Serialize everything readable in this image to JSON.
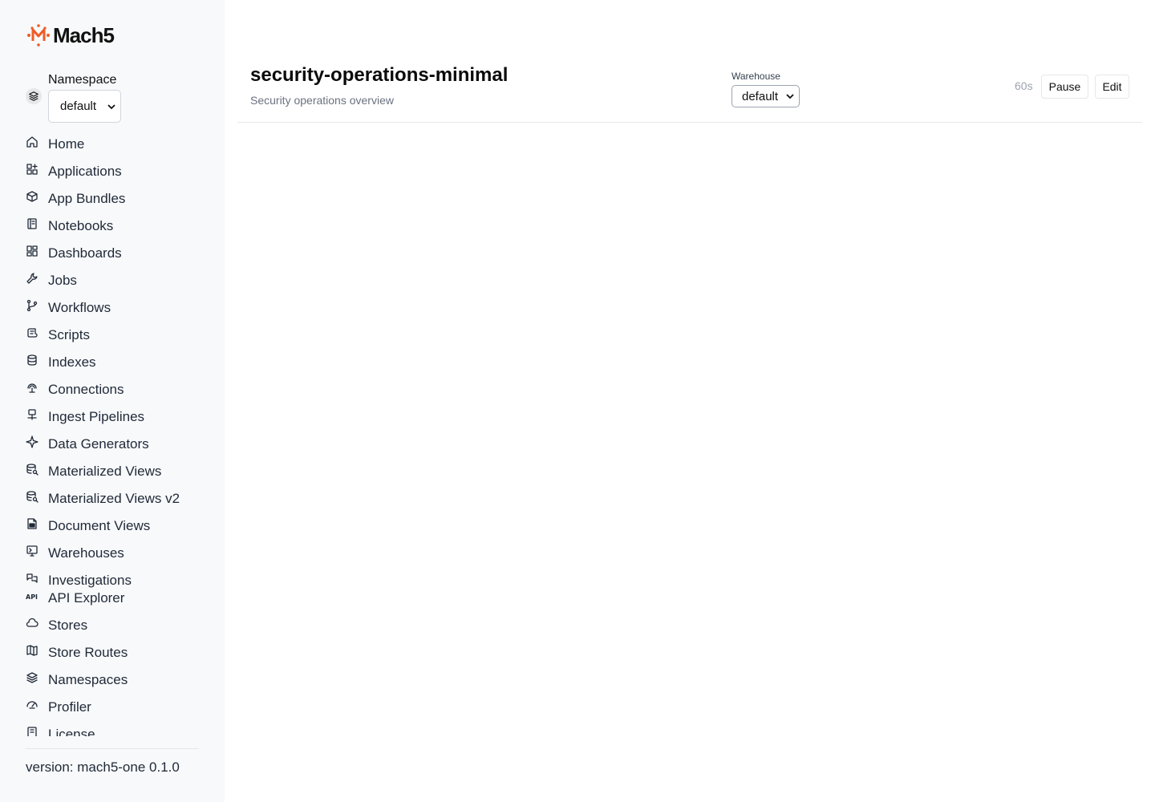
{
  "brand": {
    "name": "Mach5",
    "accent": "#ef5b25"
  },
  "namespace": {
    "label": "Namespace",
    "selected": "default"
  },
  "nav": {
    "items": [
      {
        "label": "Home",
        "icon": "home-icon"
      },
      {
        "label": "Applications",
        "icon": "applications-icon"
      },
      {
        "label": "App Bundles",
        "icon": "package-icon"
      },
      {
        "label": "Notebooks",
        "icon": "notebook-icon"
      },
      {
        "label": "Dashboards",
        "icon": "dashboard-icon"
      },
      {
        "label": "Jobs",
        "icon": "wrench-icon"
      },
      {
        "label": "Workflows",
        "icon": "git-branch-icon"
      },
      {
        "label": "Scripts",
        "icon": "script-icon"
      },
      {
        "label": "Indexes",
        "icon": "database-icon"
      },
      {
        "label": "Connections",
        "icon": "cable-icon"
      },
      {
        "label": "Ingest Pipelines",
        "icon": "network-icon"
      },
      {
        "label": "Data Generators",
        "icon": "sparkle-icon"
      },
      {
        "label": "Materialized Views",
        "icon": "database-search-icon"
      },
      {
        "label": "Materialized Views v2",
        "icon": "database-search-icon"
      },
      {
        "label": "Document Views",
        "icon": "file-icon"
      },
      {
        "label": "Warehouses",
        "icon": "monitor-icon"
      },
      {
        "label": "Investigations",
        "icon": "chat-icon"
      },
      {
        "label": "API Explorer",
        "icon": "api-icon"
      },
      {
        "label": "Stores",
        "icon": "cloud-icon"
      },
      {
        "label": "Store Routes",
        "icon": "map-icon"
      },
      {
        "label": "Namespaces",
        "icon": "layers-icon"
      },
      {
        "label": "Profiler",
        "icon": "gauge-icon"
      },
      {
        "label": "License",
        "icon": "license-icon"
      }
    ]
  },
  "footer": {
    "version": "version: mach5-one 0.1.0"
  },
  "header": {
    "title": "security-operations-minimal",
    "subtitle": "Security operations overview",
    "warehouse_label": "Warehouse",
    "warehouse_selected": "default",
    "refresh_interval": "60s",
    "pause_label": "Pause",
    "edit_label": "Edit"
  }
}
